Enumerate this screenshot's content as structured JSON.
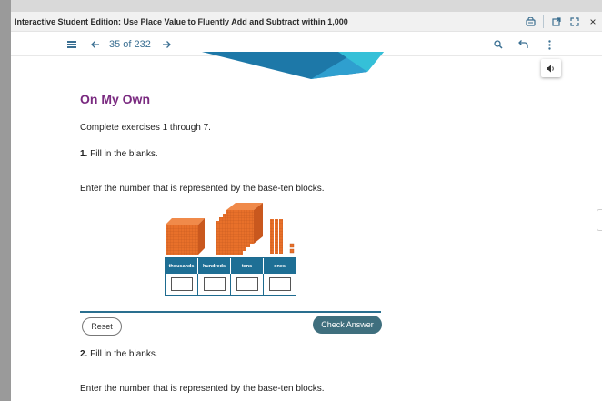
{
  "window": {
    "title": "Interactive Student Edition: Use Place Value to Fluently Add and Subtract within 1,000",
    "icons": [
      "lock-icon",
      "open-external-icon",
      "expand-icon",
      "close-icon"
    ],
    "close_glyph": "×"
  },
  "navbar": {
    "page_label": "35 of 232",
    "icons": [
      "menu-icon",
      "back-arrow-icon",
      "forward-arrow-icon",
      "search-icon",
      "undo-icon",
      "more-icon"
    ]
  },
  "content": {
    "heading": "On My Own",
    "instructions": "Complete exercises 1 through 7.",
    "exercise1": {
      "number": "1.",
      "prompt": "Fill in the blanks.",
      "question": "Enter the number that is represented by the base-ten blocks."
    },
    "place_value_table": {
      "headers": [
        "thousands",
        "hundreds",
        "tens",
        "ones"
      ]
    },
    "buttons": {
      "reset": "Reset",
      "check": "Check Answer"
    },
    "exercise2": {
      "number": "2.",
      "prompt": "Fill in the blanks.",
      "question": "Enter the number that is represented by the base-ten blocks."
    }
  },
  "colors": {
    "heading": "#7a2a80",
    "accent": "#1e6f95",
    "check_button": "#3f6f7e",
    "block_orange": "#e8702a"
  }
}
